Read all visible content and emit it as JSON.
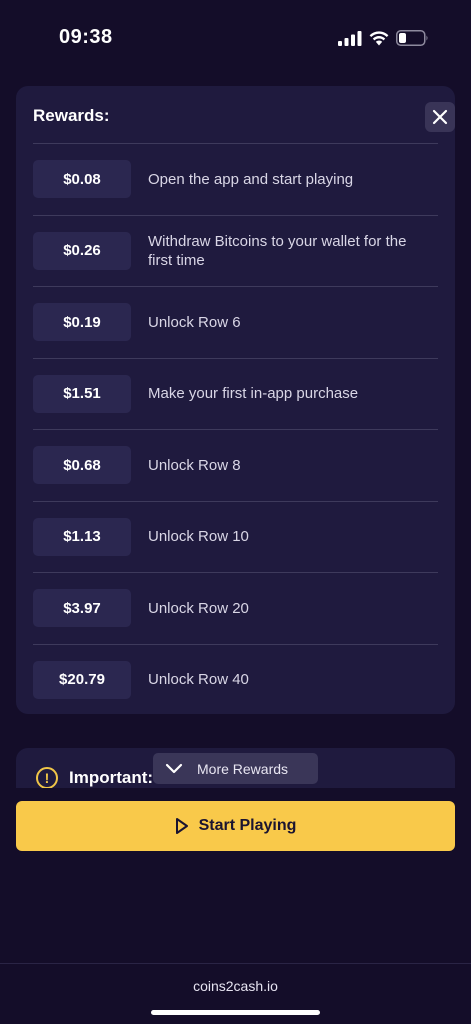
{
  "status_bar": {
    "time": "09:38"
  },
  "rewards": {
    "title": "Rewards:",
    "items": [
      {
        "amount": "$0.08",
        "description": "Open the app and start playing"
      },
      {
        "amount": "$0.26",
        "description": "Withdraw Bitcoins to your wallet for the first time"
      },
      {
        "amount": "$0.19",
        "description": "Unlock Row 6"
      },
      {
        "amount": "$1.51",
        "description": "Make your first in-app purchase"
      },
      {
        "amount": "$0.68",
        "description": "Unlock Row 8"
      },
      {
        "amount": "$1.13",
        "description": "Unlock Row 10"
      },
      {
        "amount": "$3.97",
        "description": "Unlock Row 20"
      },
      {
        "amount": "$20.79",
        "description": "Unlock Row 40"
      }
    ]
  },
  "important": {
    "icon": "!",
    "label": "Important:"
  },
  "more_rewards": {
    "label": "More Rewards"
  },
  "start_button": {
    "label": "Start Playing"
  },
  "footer": {
    "domain": "coins2cash.io"
  },
  "colors": {
    "accent": "#f9c94a",
    "background": "#140d29",
    "card": "#1f1a3e"
  }
}
